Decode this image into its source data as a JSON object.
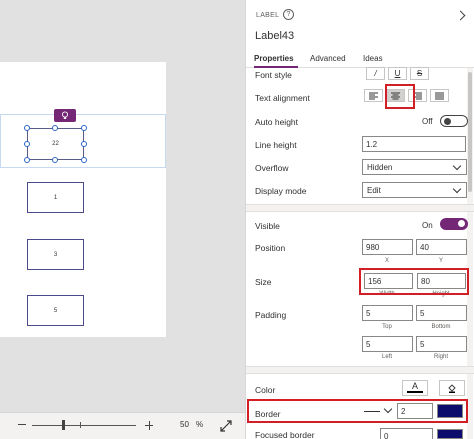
{
  "canvas": {
    "labels": [
      {
        "text": "22"
      },
      {
        "text": "1"
      },
      {
        "text": "3"
      },
      {
        "text": "5"
      }
    ]
  },
  "zoom": {
    "value": "50",
    "unit": "%"
  },
  "panel": {
    "type_label": "LABEL",
    "control_name": "Label43",
    "tabs": [
      "Properties",
      "Advanced",
      "Ideas"
    ],
    "font_style": {
      "label": "Font style",
      "buttons": [
        "/",
        "U",
        "S"
      ]
    },
    "text_alignment": {
      "label": "Text alignment"
    },
    "auto_height": {
      "label": "Auto height",
      "state": "Off"
    },
    "line_height": {
      "label": "Line height",
      "value": "1.2"
    },
    "overflow": {
      "label": "Overflow",
      "value": "Hidden"
    },
    "display_mode": {
      "label": "Display mode",
      "value": "Edit"
    },
    "visible": {
      "label": "Visible",
      "state": "On"
    },
    "position": {
      "label": "Position",
      "x": "980",
      "y": "40",
      "x_label": "X",
      "y_label": "Y"
    },
    "size": {
      "label": "Size",
      "width": "156",
      "height": "80",
      "width_label": "Width",
      "height_label": "Height"
    },
    "padding": {
      "label": "Padding",
      "top": "5",
      "bottom": "5",
      "left": "5",
      "right": "5",
      "top_label": "Top",
      "bottom_label": "Bottom",
      "left_label": "Left",
      "right_label": "Right"
    },
    "color": {
      "label": "Color",
      "font_glyph": "A"
    },
    "border": {
      "label": "Border",
      "thickness": "2",
      "color": "#0c0c6c"
    },
    "focused_border": {
      "label": "Focused border",
      "thickness": "0"
    }
  },
  "colors": {
    "accent": "#742774",
    "highlight": "#d21f26"
  }
}
